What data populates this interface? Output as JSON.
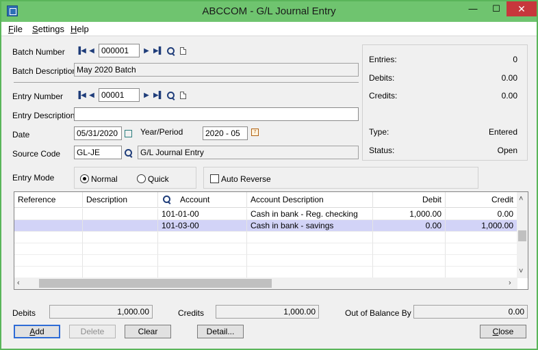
{
  "window": {
    "title": "ABCCOM - G/L Journal Entry"
  },
  "window_controls": {
    "minimize": "—",
    "maximize": "☐",
    "close": "✕"
  },
  "menu": [
    {
      "key": "F",
      "rest": "ile"
    },
    {
      "key": "S",
      "rest": "ettings"
    },
    {
      "key": "H",
      "rest": "elp"
    }
  ],
  "batch": {
    "number_label": "Batch Number",
    "number": "000001",
    "description_label": "Batch Description",
    "description": "May 2020 Batch"
  },
  "entry": {
    "number_label": "Entry Number",
    "number": "00001",
    "description_label": "Entry Description",
    "description": "",
    "date_label": "Date",
    "date": "05/31/2020",
    "period_label": "Year/Period",
    "period": "2020 - 05",
    "source_label": "Source Code",
    "source_code": "GL-JE",
    "source_desc": "G/L Journal Entry",
    "mode_label": "Entry Mode",
    "mode_normal": "Normal",
    "mode_quick": "Quick",
    "mode_selected": "Normal",
    "auto_reverse_label": "Auto Reverse",
    "auto_reverse": false
  },
  "summary": {
    "entries_label": "Entries:",
    "entries": "0",
    "debits_label": "Debits:",
    "debits": "0.00",
    "credits_label": "Credits:",
    "credits": "0.00",
    "type_label": "Type:",
    "type": "Entered",
    "status_label": "Status:",
    "status": "Open"
  },
  "grid": {
    "columns": [
      "Reference",
      "Description",
      "Account",
      "Account Description",
      "Debit",
      "Credit"
    ],
    "rows": [
      {
        "reference": "",
        "description": "",
        "account": "101-01-00",
        "account_description": "Cash in bank - Reg. checking",
        "debit": "1,000.00",
        "credit": "0.00",
        "selected": false
      },
      {
        "reference": "",
        "description": "",
        "account": "101-03-00",
        "account_description": "Cash in bank - savings",
        "debit": "0.00",
        "credit": "1,000.00",
        "selected": true
      }
    ]
  },
  "totals": {
    "debits_label": "Debits",
    "debits": "1,000.00",
    "credits_label": "Credits",
    "credits": "1,000.00",
    "out_of_balance_label": "Out of Balance By",
    "out_of_balance": "0.00"
  },
  "buttons": {
    "add": {
      "key": "A",
      "rest": "dd"
    },
    "delete": "Delete",
    "clear": "Clear",
    "detail": "Detail...",
    "close": {
      "key": "C",
      "rest": "lose"
    }
  },
  "icons": {
    "first": "first-record-icon",
    "prev": "previous-record-icon",
    "next": "next-record-icon",
    "last": "last-record-icon",
    "finder": "search-icon",
    "new": "new-document-icon"
  },
  "colors": {
    "title_bar": "#6fc46f",
    "close_button": "#c7373c",
    "selected_row": "#d2d3f7"
  }
}
